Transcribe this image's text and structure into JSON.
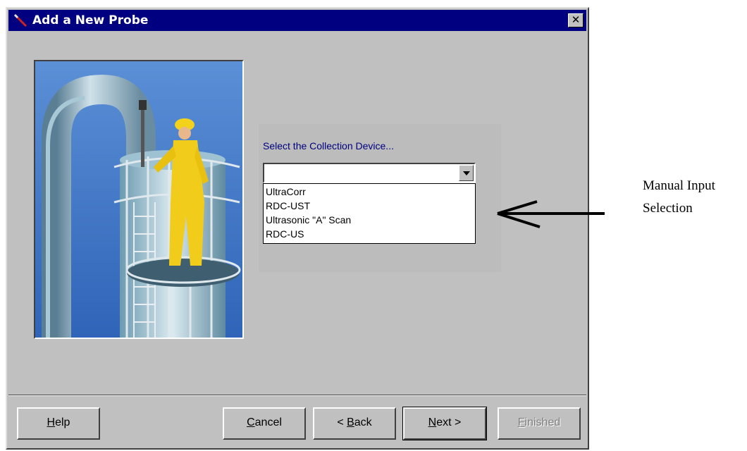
{
  "dialog": {
    "title": "Add a New Probe",
    "close_glyph": "✕"
  },
  "prompt": "Select the Collection Device...",
  "combo": {
    "selected": ""
  },
  "options": [
    "UltraCorr",
    "RDC-UST",
    "Ultrasonic \"A\" Scan",
    "RDC-US"
  ],
  "buttons": {
    "help": {
      "mnemonic": "H",
      "rest": "elp"
    },
    "cancel": {
      "mnemonic": "C",
      "rest": "ancel"
    },
    "back": {
      "prefix": "< ",
      "mnemonic": "B",
      "rest": "ack"
    },
    "next": {
      "mnemonic": "N",
      "rest": "ext >"
    },
    "finished": {
      "mnemonic": "F",
      "rest": "inished"
    }
  },
  "annotation": {
    "line1": "Manual Input",
    "line2": "Selection"
  },
  "icons": {
    "title": "probe-icon",
    "photo": "refinery-photo",
    "combo_arrow": "chevron-down-icon",
    "pointer": "arrow-left-icon"
  },
  "colors": {
    "titlebar": "#000080",
    "face": "#c0c0c0",
    "prompt_text": "#000080"
  }
}
